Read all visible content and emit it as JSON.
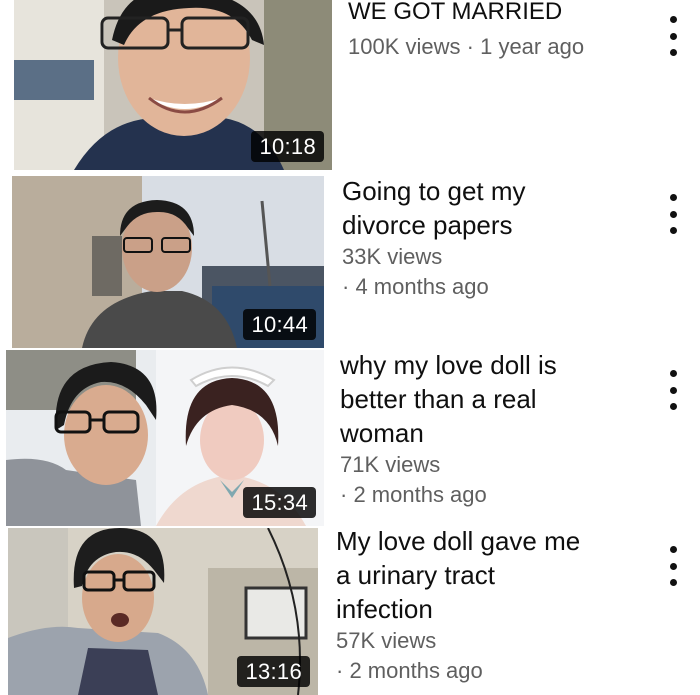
{
  "videos": [
    {
      "title": "WE GOT MARRIED",
      "views": "100K views",
      "separator": "·",
      "age": "1 year ago",
      "duration": "10:18"
    },
    {
      "title_lines": [
        "Going to get my",
        "divorce papers"
      ],
      "views": "33K views",
      "separator": "·",
      "age": "4 months ago",
      "duration": "10:44"
    },
    {
      "title_lines": [
        "why my love doll is",
        "better than a real",
        "woman"
      ],
      "views": "71K views",
      "separator": "·",
      "age": "2 months ago",
      "duration": "15:34"
    },
    {
      "title_lines": [
        "My love doll gave me",
        "a urinary tract",
        "infection"
      ],
      "views": "57K views",
      "separator": "·",
      "age": "2 months ago",
      "duration": "13:16"
    }
  ],
  "icons": {
    "menu": "vertical-ellipsis-icon"
  },
  "colors": {
    "title": "#0f0f0f",
    "meta": "#5f5f5f",
    "duration_bg": "#000000",
    "background": "#ffffff"
  }
}
